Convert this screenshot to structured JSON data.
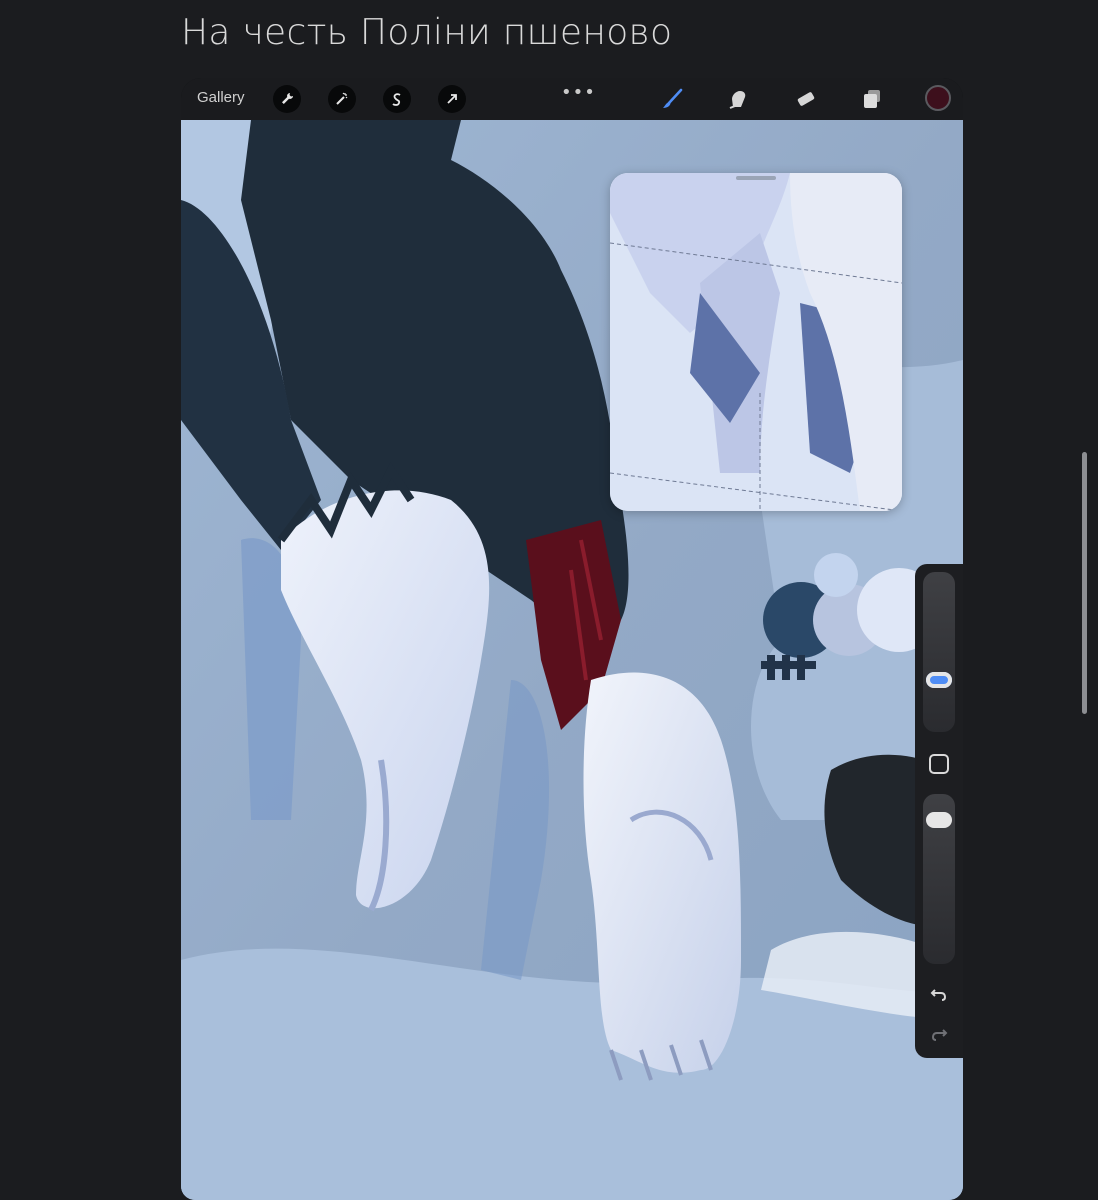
{
  "page": {
    "title": "На честь Поліни пшеново"
  },
  "toolbar": {
    "gallery_label": "Gallery",
    "left_tools": [
      {
        "name": "actions-wrench-icon"
      },
      {
        "name": "adjustments-magic-wand-icon"
      },
      {
        "name": "selection-s-icon"
      },
      {
        "name": "transform-arrow-icon"
      }
    ],
    "more_label": "•••",
    "right_tools": [
      {
        "name": "brush-icon",
        "active": true
      },
      {
        "name": "smudge-icon"
      },
      {
        "name": "eraser-icon"
      },
      {
        "name": "layers-icon"
      }
    ],
    "current_color": "#3d0f1c",
    "accent_color": "#4f8df5"
  },
  "reference_window": {
    "visible": true
  },
  "sidebar": {
    "brush_size_level": 0.3,
    "brush_opacity_level": 0.9,
    "undo": "undo-icon",
    "redo": "redo-icon"
  }
}
